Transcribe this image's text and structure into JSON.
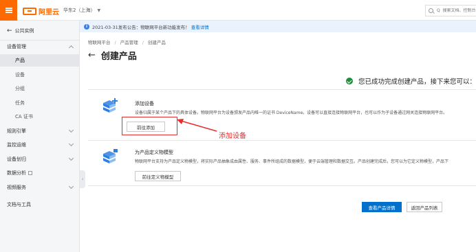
{
  "topbar": {
    "logo_text": "阿里云",
    "region": "华东2（上海）",
    "search_placeholder": "Q  搜索文档、控制台..."
  },
  "sidebar": {
    "back_label": "公共实例",
    "items": [
      {
        "label": "设备管理",
        "chevron": "up"
      },
      {
        "label": "产品",
        "active": true
      },
      {
        "label": "设备"
      },
      {
        "label": "分组"
      },
      {
        "label": "任务"
      },
      {
        "label": "CA 证书"
      },
      {
        "label": "规则引擎",
        "chevron": "down"
      },
      {
        "label": "监控运维",
        "chevron": "down"
      },
      {
        "label": "设备划归",
        "chevron": "down"
      },
      {
        "label": "数据分析",
        "external": true
      },
      {
        "label": "视频服务",
        "chevron": "down"
      },
      {
        "label": "文档与工具"
      }
    ]
  },
  "notice": {
    "text": "2021-03-31发布公告：物联网平台新功能发布！",
    "link": "查看详情"
  },
  "breadcrumb": [
    "物联网平台",
    "产品管理",
    "创建产品"
  ],
  "page_title": "创建产品",
  "success_text": "您已成功完成创建产品，接下来您可以：",
  "cards": {
    "add_device": {
      "title": "添加设备",
      "desc": "设备归属于某个产品下的具体设备。物联网平台为设备颁发产品内唯一的证书 DeviceName。设备可以直接连接物联网平台，也可以作为子设备通过网关连接物联网平台。",
      "button": "前往添加"
    },
    "thing_model": {
      "title": "为产品定义物模型",
      "desc": "物联网平台支持为产品定义物模型，将实际产品抽象成由属性、服务、事件所组成的数据模型，便于云端管理和数据交互。产品创建完成后，您可以为它定义物模型，产品下",
      "button": "前往定义物模型"
    }
  },
  "footer_buttons": {
    "view_detail": "查看产品详情",
    "back_list": "返回产品列表"
  },
  "annotation_text": "添加设备",
  "colors": {
    "brand": "#ff6a00",
    "primary": "#0070cc",
    "success": "#1e8e3e",
    "annotation": "#e52e2e",
    "icon_blue": "#2f7fe0"
  }
}
